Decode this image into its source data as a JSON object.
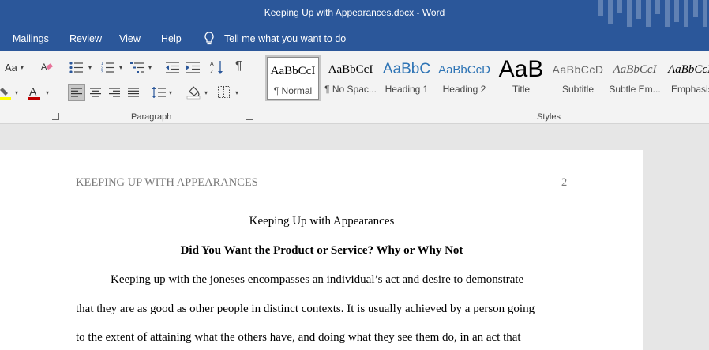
{
  "window": {
    "title": "Keeping Up with Appearances.docx  -  Word"
  },
  "tabs": [
    "Mailings",
    "Review",
    "View",
    "Help"
  ],
  "tellme": {
    "placeholder": "Tell me what you want to do"
  },
  "ribbon": {
    "font_group": {
      "case_label": "Aa"
    },
    "paragraph_group": {
      "label": "Paragraph",
      "pilcrow": "¶"
    },
    "styles_group": {
      "label": "Styles",
      "tiles": [
        {
          "sample": "AaBbCcI",
          "name": "¶ Normal",
          "selected": true
        },
        {
          "sample": "AaBbCcI",
          "name": "¶ No Spac..."
        },
        {
          "sample": "AaBbC",
          "name": "Heading 1"
        },
        {
          "sample": "AaBbCcD",
          "name": "Heading 2"
        },
        {
          "sample": "AaB",
          "name": "Title"
        },
        {
          "sample": "AaBbCcD",
          "name": "Subtitle"
        },
        {
          "sample": "AaBbCcI",
          "name": "Subtle Em..."
        },
        {
          "sample": "AaBbCcI",
          "name": "Emphasis"
        }
      ]
    }
  },
  "document": {
    "header_text": "KEEPING UP WITH APPEARANCES",
    "page_number": "2",
    "title": "Keeping Up with Appearances",
    "heading": "Did You Want the Product or Service? Why or Why Not",
    "lines": [
      "Keeping up with the joneses encompasses an individual’s act and desire to demonstrate",
      "that they are as good as other people in distinct contexts. It is usually achieved by a person going",
      "to the extent of attaining what the others have, and doing what they see them do, in an act that"
    ]
  },
  "colors": {
    "brand": "#2b579a",
    "ribbon": "#f3f3f3",
    "workspace": "#e6e6e6",
    "heading1": "#2e74b5",
    "font_color_red": "#c00000",
    "highlight_yellow": "#ffff00"
  }
}
